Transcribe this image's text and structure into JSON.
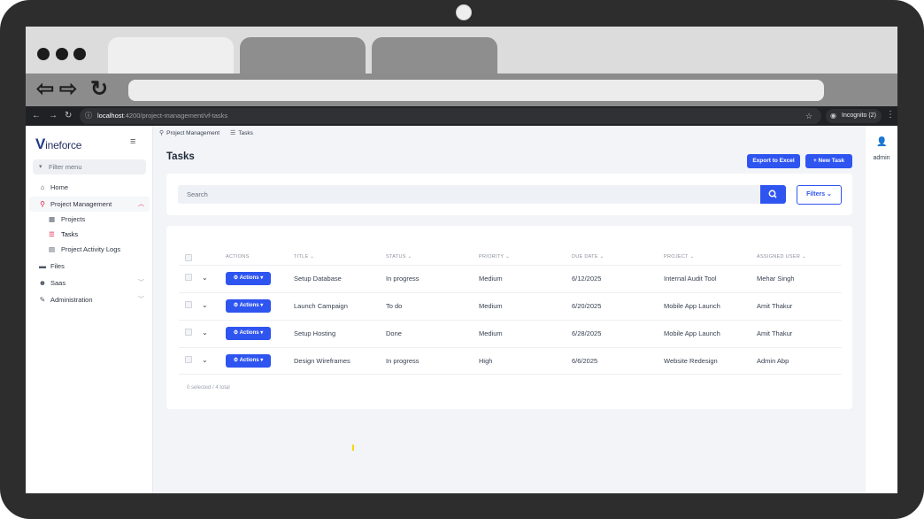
{
  "browser": {
    "url_host": "localhost",
    "url_path": ":4200/project-management/vf-tasks",
    "incognito_label": "Incognito (2)"
  },
  "sidebar": {
    "logo_text": "ineforce",
    "logo_letter": "V",
    "filter_placeholder": "Filter menu",
    "items": [
      {
        "label": "Home",
        "icon": "home-icon"
      },
      {
        "label": "Project Management",
        "icon": "project-management-icon",
        "expanded": true
      },
      {
        "label": "Files",
        "icon": "folder-icon"
      },
      {
        "label": "Saas",
        "icon": "users-icon"
      },
      {
        "label": "Administration",
        "icon": "wrench-icon"
      }
    ],
    "subitems": [
      {
        "label": "Projects",
        "icon": "table-icon"
      },
      {
        "label": "Tasks",
        "icon": "list-icon",
        "active": true
      },
      {
        "label": "Project Activity Logs",
        "icon": "document-icon"
      }
    ]
  },
  "breadcrumb": [
    "Project Management",
    "Tasks"
  ],
  "page": {
    "title": "Tasks",
    "export_label": "Export to Excel",
    "new_task_label": "New Task",
    "search_placeholder": "Search",
    "filters_label": "Filters"
  },
  "table": {
    "columns": [
      "ACTIONS",
      "TITLE",
      "STATUS",
      "PRIORITY",
      "DUE DATE",
      "PROJECT",
      "ASSIGNED USER"
    ],
    "action_label": "Actions",
    "rows": [
      {
        "title": "Setup Database",
        "status": "In progress",
        "priority": "Medium",
        "due": "6/12/2025",
        "project": "Internal Audit Tool",
        "user": "Mehar Singh"
      },
      {
        "title": "Launch Campaign",
        "status": "To do",
        "priority": "Medium",
        "due": "6/20/2025",
        "project": "Mobile App Launch",
        "user": "Amit Thakur"
      },
      {
        "title": "Setup Hosting",
        "status": "Done",
        "priority": "Medium",
        "due": "6/28/2025",
        "project": "Mobile App Launch",
        "user": "Amit Thakur"
      },
      {
        "title": "Design Wireframes",
        "status": "In progress",
        "priority": "High",
        "due": "6/6/2025",
        "project": "Website Redesign",
        "user": "Admin Abp"
      }
    ],
    "selection_info": "0 selected / 4 total"
  },
  "user": {
    "name": "admin"
  },
  "colors": {
    "primary": "#2f55f0",
    "accent": "#e11d48"
  }
}
